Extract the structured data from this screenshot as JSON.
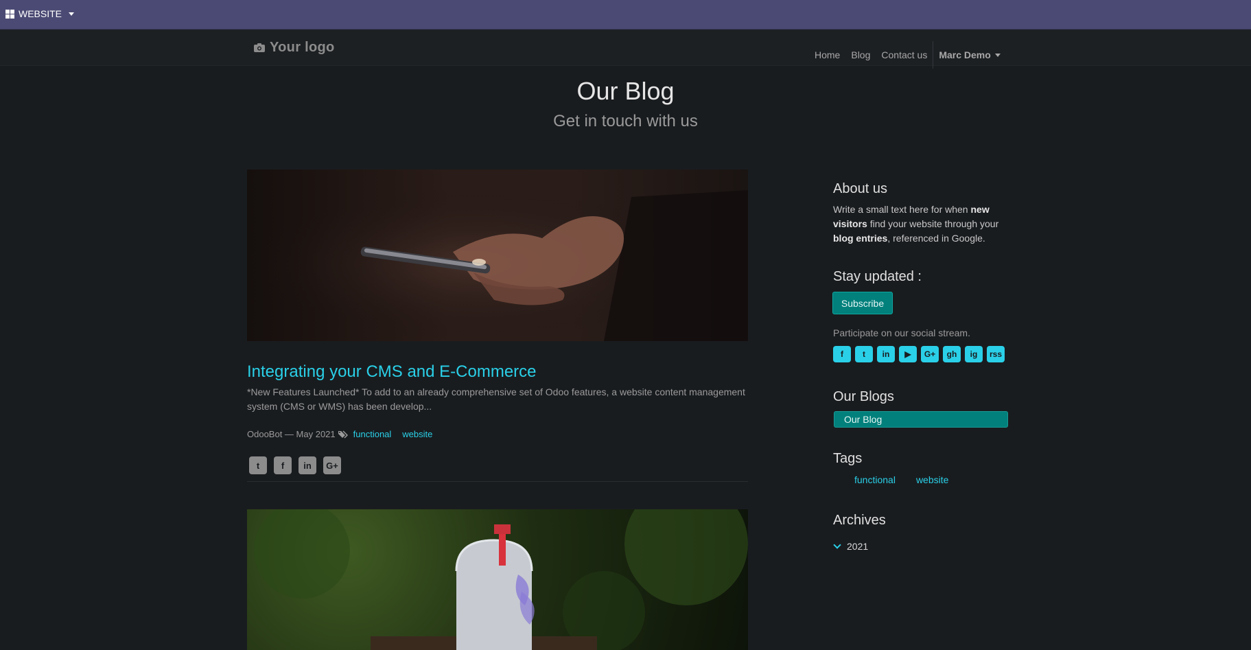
{
  "topbar": {
    "app_label": "WEBSITE"
  },
  "navbar": {
    "logo_text": "Your logo",
    "links": [
      "Home",
      "Blog",
      "Contact us"
    ],
    "user": "Marc Demo"
  },
  "hero": {
    "title": "Our Blog",
    "subtitle": "Get in touch with us"
  },
  "post": {
    "title": "Integrating your CMS and E-Commerce",
    "excerpt": "*New Features Launched* To add to an already comprehensive set of Odoo features, a website content management system (CMS or WMS) has been develop...",
    "meta": "OdooBot — May 2021",
    "tags": [
      "functional",
      "website"
    ],
    "share": [
      "t",
      "f",
      "in",
      "G+"
    ]
  },
  "sidebar": {
    "about_title": "About us",
    "about_text": {
      "p1": "Write a small text here for when ",
      "b1": "new visitors",
      "p2": " find your website through your ",
      "b2": "blog entries",
      "p3": ", referenced in Google."
    },
    "stay_title": "Stay updated :",
    "subscribe_label": "Subscribe",
    "social_text": "Participate on our social stream.",
    "social_icons": [
      "f",
      "t",
      "in",
      "▶",
      "G+",
      "gh",
      "ig",
      "rss"
    ],
    "blogs_title": "Our Blogs",
    "blogs": [
      "Our Blog"
    ],
    "tags_title": "Tags",
    "tags": [
      "functional",
      "website"
    ],
    "archives_title": "Archives",
    "archive_year": "2021"
  },
  "colors": {
    "topbar": "#4b4a74",
    "accent": "#2ad0e8",
    "primary": "#01807c",
    "background": "#191c1f"
  }
}
